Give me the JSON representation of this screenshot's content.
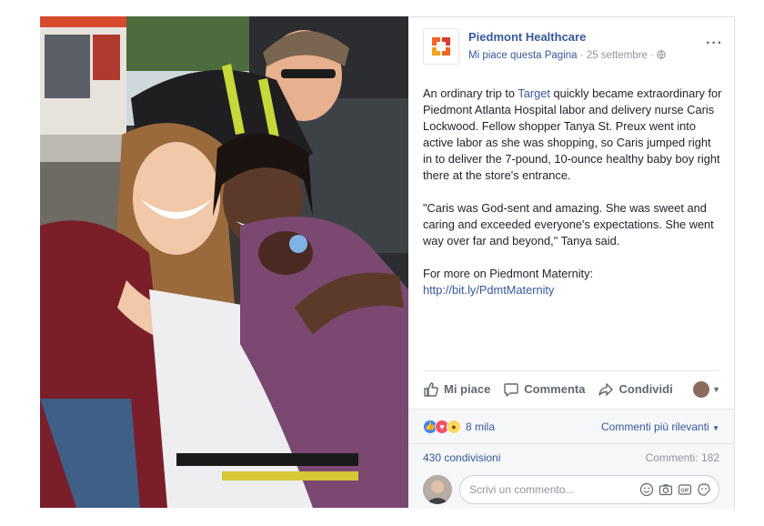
{
  "post": {
    "page_name": "Piedmont Healthcare",
    "like_page": "Mi piace questa Pagina",
    "separator": "·",
    "date": "25 settembre",
    "more": "···"
  },
  "body": {
    "p1_before": "An ordinary trip to ",
    "p1_link": "Target",
    "p1_after": " quickly became extraordinary for Piedmont Atlanta Hospital labor and delivery nurse Caris Lockwood. Fellow shopper Tanya St. Preux went into active labor as she was shopping, so Caris jumped right in to deliver the 7-pound, 10-ounce healthy baby boy right there at the store's entrance.",
    "p2": "\"Caris was God-sent and amazing. She was sweet and caring and exceeded everyone's expectations. She went way over far and beyond,\" Tanya said.",
    "p3_before": "For more on Piedmont Maternity: ",
    "p3_link": "http://bit.ly/PdmtMaternity"
  },
  "actions": {
    "like": "Mi piace",
    "comment": "Commenta",
    "share": "Condividi"
  },
  "reactions": {
    "count": "8 mila",
    "sort": "Commenti più rilevanti"
  },
  "stats": {
    "shares": "430 condivisioni",
    "comments": "Commenti: 182"
  },
  "comment_input": {
    "placeholder": "Scrivi un commento..."
  },
  "icons": {
    "like": "thumbs-up-icon",
    "comment": "speech-bubble-icon",
    "share": "share-arrow-icon",
    "globe": "globe-icon",
    "emoji": "emoji-icon",
    "camera": "camera-icon",
    "gif": "gif-icon",
    "sticker": "sticker-icon"
  },
  "colors": {
    "link": "#365899",
    "brand_orange": "#f26522",
    "like_blue": "#4080ff",
    "love_red": "#f25268",
    "wow_yellow": "#fcd95f"
  }
}
